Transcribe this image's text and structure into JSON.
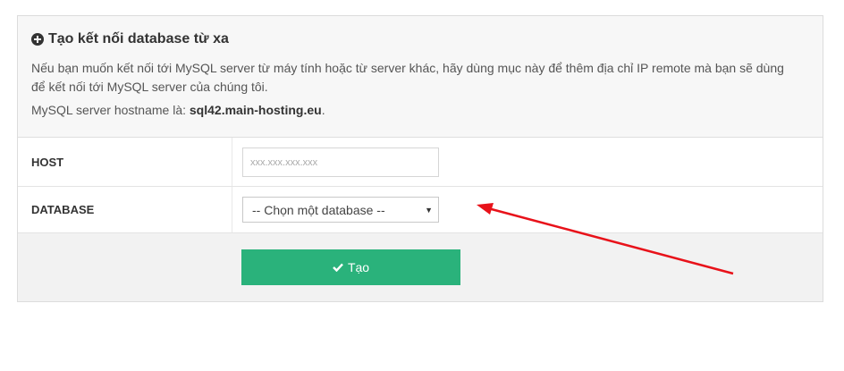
{
  "panel": {
    "title": "Tạo kết nối database từ xa",
    "title_icon": "plus-circle-icon",
    "description": "Nếu bạn muốn kết nối tới MySQL server từ máy tính hoặc từ server khác, hãy dùng mục này để thêm địa chỉ IP remote mà bạn sẽ dùng để kết nối tới MySQL server của chúng tôi.",
    "hostname_prefix": "MySQL server hostname là: ",
    "hostname_value": "sql42.main-hosting.eu",
    "hostname_suffix": "."
  },
  "form": {
    "host_label": "HOST",
    "host_placeholder": "xxx.xxx.xxx.xxx",
    "host_value": "",
    "database_label": "DATABASE",
    "database_selected": "-- Chọn một database --",
    "database_caret": "▼"
  },
  "actions": {
    "create_label": "Tạo",
    "create_icon": "check-icon",
    "button_color": "#2ab27b"
  },
  "annotation": {
    "arrow_color": "#e8121a",
    "arrow_icon": "red-arrow-annotation"
  }
}
